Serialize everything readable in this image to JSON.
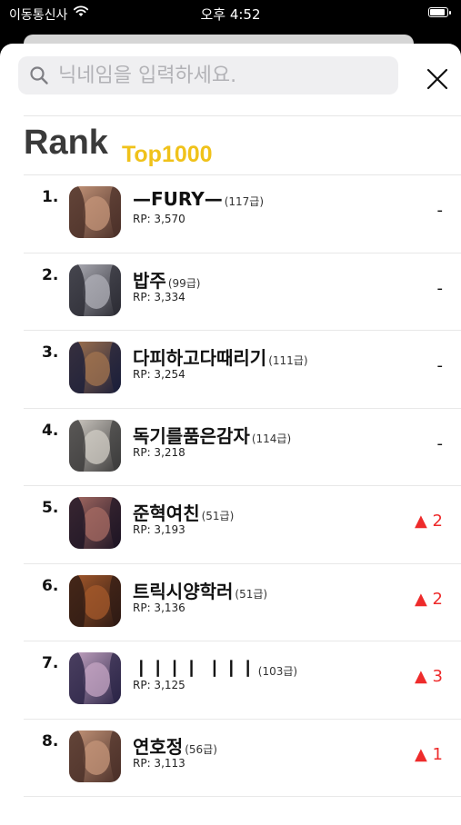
{
  "status_bar": {
    "carrier": "이동통신사",
    "time": "오후 4:52"
  },
  "search": {
    "placeholder": "닉네임을 입력하세요.",
    "value": ""
  },
  "header": {
    "title": "Rank",
    "subtitle": "Top1000"
  },
  "ranks": [
    {
      "rank": "1.",
      "name": "—FURY—",
      "level": "(117급)",
      "rp": "RP: 3,570",
      "change": "-",
      "trend": "none",
      "avatar_colors": [
        "#c6967a",
        "#4a2f28"
      ]
    },
    {
      "rank": "2.",
      "name": "밥주",
      "level": "(99급)",
      "rp": "RP: 3,334",
      "change": "-",
      "trend": "none",
      "avatar_colors": [
        "#b0b0b8",
        "#2b2b33"
      ]
    },
    {
      "rank": "3.",
      "name": "다피하고다때리기",
      "level": "(111급)",
      "rp": "RP: 3,254",
      "change": "-",
      "trend": "none",
      "avatar_colors": [
        "#a3744f",
        "#1a1e3a"
      ]
    },
    {
      "rank": "4.",
      "name": "독기를품은감자",
      "level": "(114급)",
      "rp": "RP: 3,218",
      "change": "-",
      "trend": "none",
      "avatar_colors": [
        "#d2cdc6",
        "#3b3a3a"
      ]
    },
    {
      "rank": "5.",
      "name": "준혁여친",
      "level": "(51급)",
      "rp": "RP: 3,193",
      "change": "▲ 2",
      "trend": "up",
      "avatar_colors": [
        "#a76b63",
        "#1c1424"
      ]
    },
    {
      "rank": "6.",
      "name": "트릭시양학러",
      "level": "(51급)",
      "rp": "RP: 3,136",
      "change": "▲ 2",
      "trend": "up",
      "avatar_colors": [
        "#a5592b",
        "#2d1a14"
      ]
    },
    {
      "rank": "7.",
      "name": "ㅣㅣㅣㅣ ㅣㅣㅣ",
      "level": "(103급)",
      "rp": "RP: 3,125",
      "change": "▲ 3",
      "trend": "up",
      "avatar_colors": [
        "#c6a6c4",
        "#2a2446"
      ]
    },
    {
      "rank": "8.",
      "name": "연호정",
      "level": "(56급)",
      "rp": "RP: 3,113",
      "change": "▲ 1",
      "trend": "up",
      "avatar_colors": [
        "#c6967a",
        "#4a2f28"
      ]
    }
  ]
}
